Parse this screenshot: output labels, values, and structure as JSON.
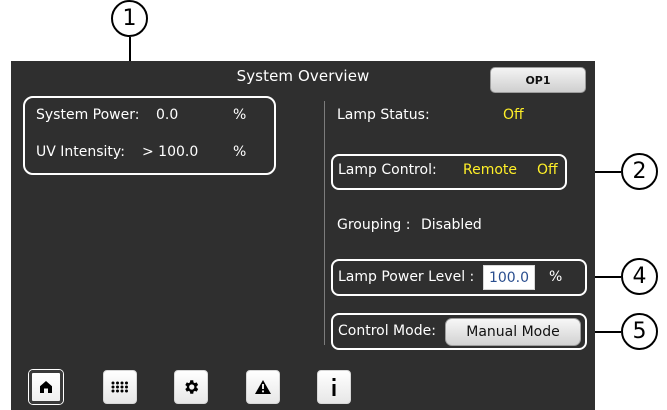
{
  "screen": {
    "title": "System Overview",
    "operator_button": "OP1"
  },
  "metrics": {
    "system_power_label": "System Power:",
    "system_power_value": "0.0",
    "system_power_unit": "%",
    "uv_intensity_label": "UV Intensity:",
    "uv_intensity_value": "> 100.0",
    "uv_intensity_unit": "%"
  },
  "status": {
    "lamp_status_label": "Lamp Status:",
    "lamp_status_value": "Off",
    "lamp_control_label": "Lamp Control:",
    "lamp_control_mode": "Remote",
    "lamp_control_state": "Off",
    "grouping_label": "Grouping :",
    "grouping_value": "Disabled",
    "lamp_power_label": "Lamp Power Level :",
    "lamp_power_value": "100.0",
    "lamp_power_unit": "%",
    "control_mode_label": "Control Mode:",
    "control_mode_button": "Manual Mode"
  },
  "navigation": {
    "items": [
      {
        "name": "home",
        "icon": "home-icon"
      },
      {
        "name": "grid",
        "icon": "grid-icon"
      },
      {
        "name": "settings",
        "icon": "gear-icon"
      },
      {
        "name": "alerts",
        "icon": "warning-icon"
      },
      {
        "name": "info",
        "icon": "info-icon"
      }
    ]
  },
  "callouts": {
    "one": "1",
    "two": "2",
    "four": "4",
    "five": "5"
  },
  "colors": {
    "panel_background": "#2f2f2f",
    "text": "#ffffff",
    "highlight": "#ffef28",
    "input_text": "#2a4e8f"
  }
}
